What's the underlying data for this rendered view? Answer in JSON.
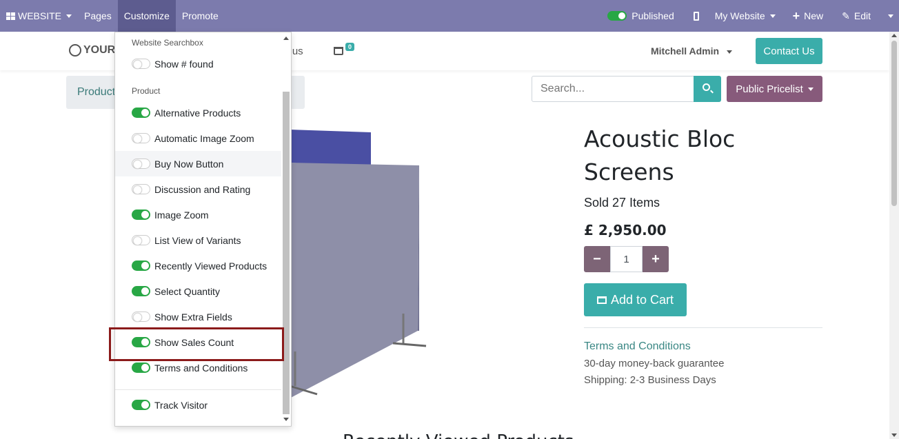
{
  "topbar": {
    "brand": "WEBSITE",
    "menus": [
      "Pages",
      "Customize",
      "Promote"
    ],
    "published_label": "Published",
    "my_website_label": "My Website",
    "new_label": "New",
    "edit_label": "Edit"
  },
  "header": {
    "logo_text": "YOUR",
    "nav_partial": "ct us",
    "cart_count": "0",
    "user_name": "Mitchell Admin",
    "contact_button": "Contact Us"
  },
  "breadcrumb": {
    "label": "Product"
  },
  "search": {
    "placeholder": "Search..."
  },
  "pricelist": {
    "label": "Public Pricelist"
  },
  "product": {
    "title_line1": "Acoustic Bloc",
    "title_line2": "Screens",
    "sold": "Sold 27 Items",
    "price": "£ 2,950.00",
    "quantity": "1",
    "add_to_cart": "Add to Cart",
    "terms_link": "Terms and Conditions",
    "guarantee": "30-day money-back guarantee",
    "shipping": "Shipping: 2-3 Business Days"
  },
  "bottom_heading": "Recently Viewed Products",
  "customize_menu": {
    "section_searchbox": "Website Searchbox",
    "show_found": {
      "label": "Show # found",
      "on": false
    },
    "section_product": "Product",
    "items": [
      {
        "label": "Alternative Products",
        "on": true
      },
      {
        "label": "Automatic Image Zoom",
        "on": false
      },
      {
        "label": "Buy Now Button",
        "on": false
      },
      {
        "label": "Discussion and Rating",
        "on": false
      },
      {
        "label": "Image Zoom",
        "on": true
      },
      {
        "label": "List View of Variants",
        "on": false
      },
      {
        "label": "Recently Viewed Products",
        "on": true
      },
      {
        "label": "Select Quantity",
        "on": true
      },
      {
        "label": "Show Extra Fields",
        "on": false
      },
      {
        "label": "Show Sales Count",
        "on": true
      },
      {
        "label": "Terms and Conditions",
        "on": true
      }
    ],
    "track_visitor": {
      "label": "Track Visitor",
      "on": true
    }
  },
  "colors": {
    "topbar": "#7c7bad",
    "accent": "#3aadaa",
    "pricelist": "#875a7b",
    "toggle_on": "#28a745",
    "highlight": "#8b1a1a"
  }
}
